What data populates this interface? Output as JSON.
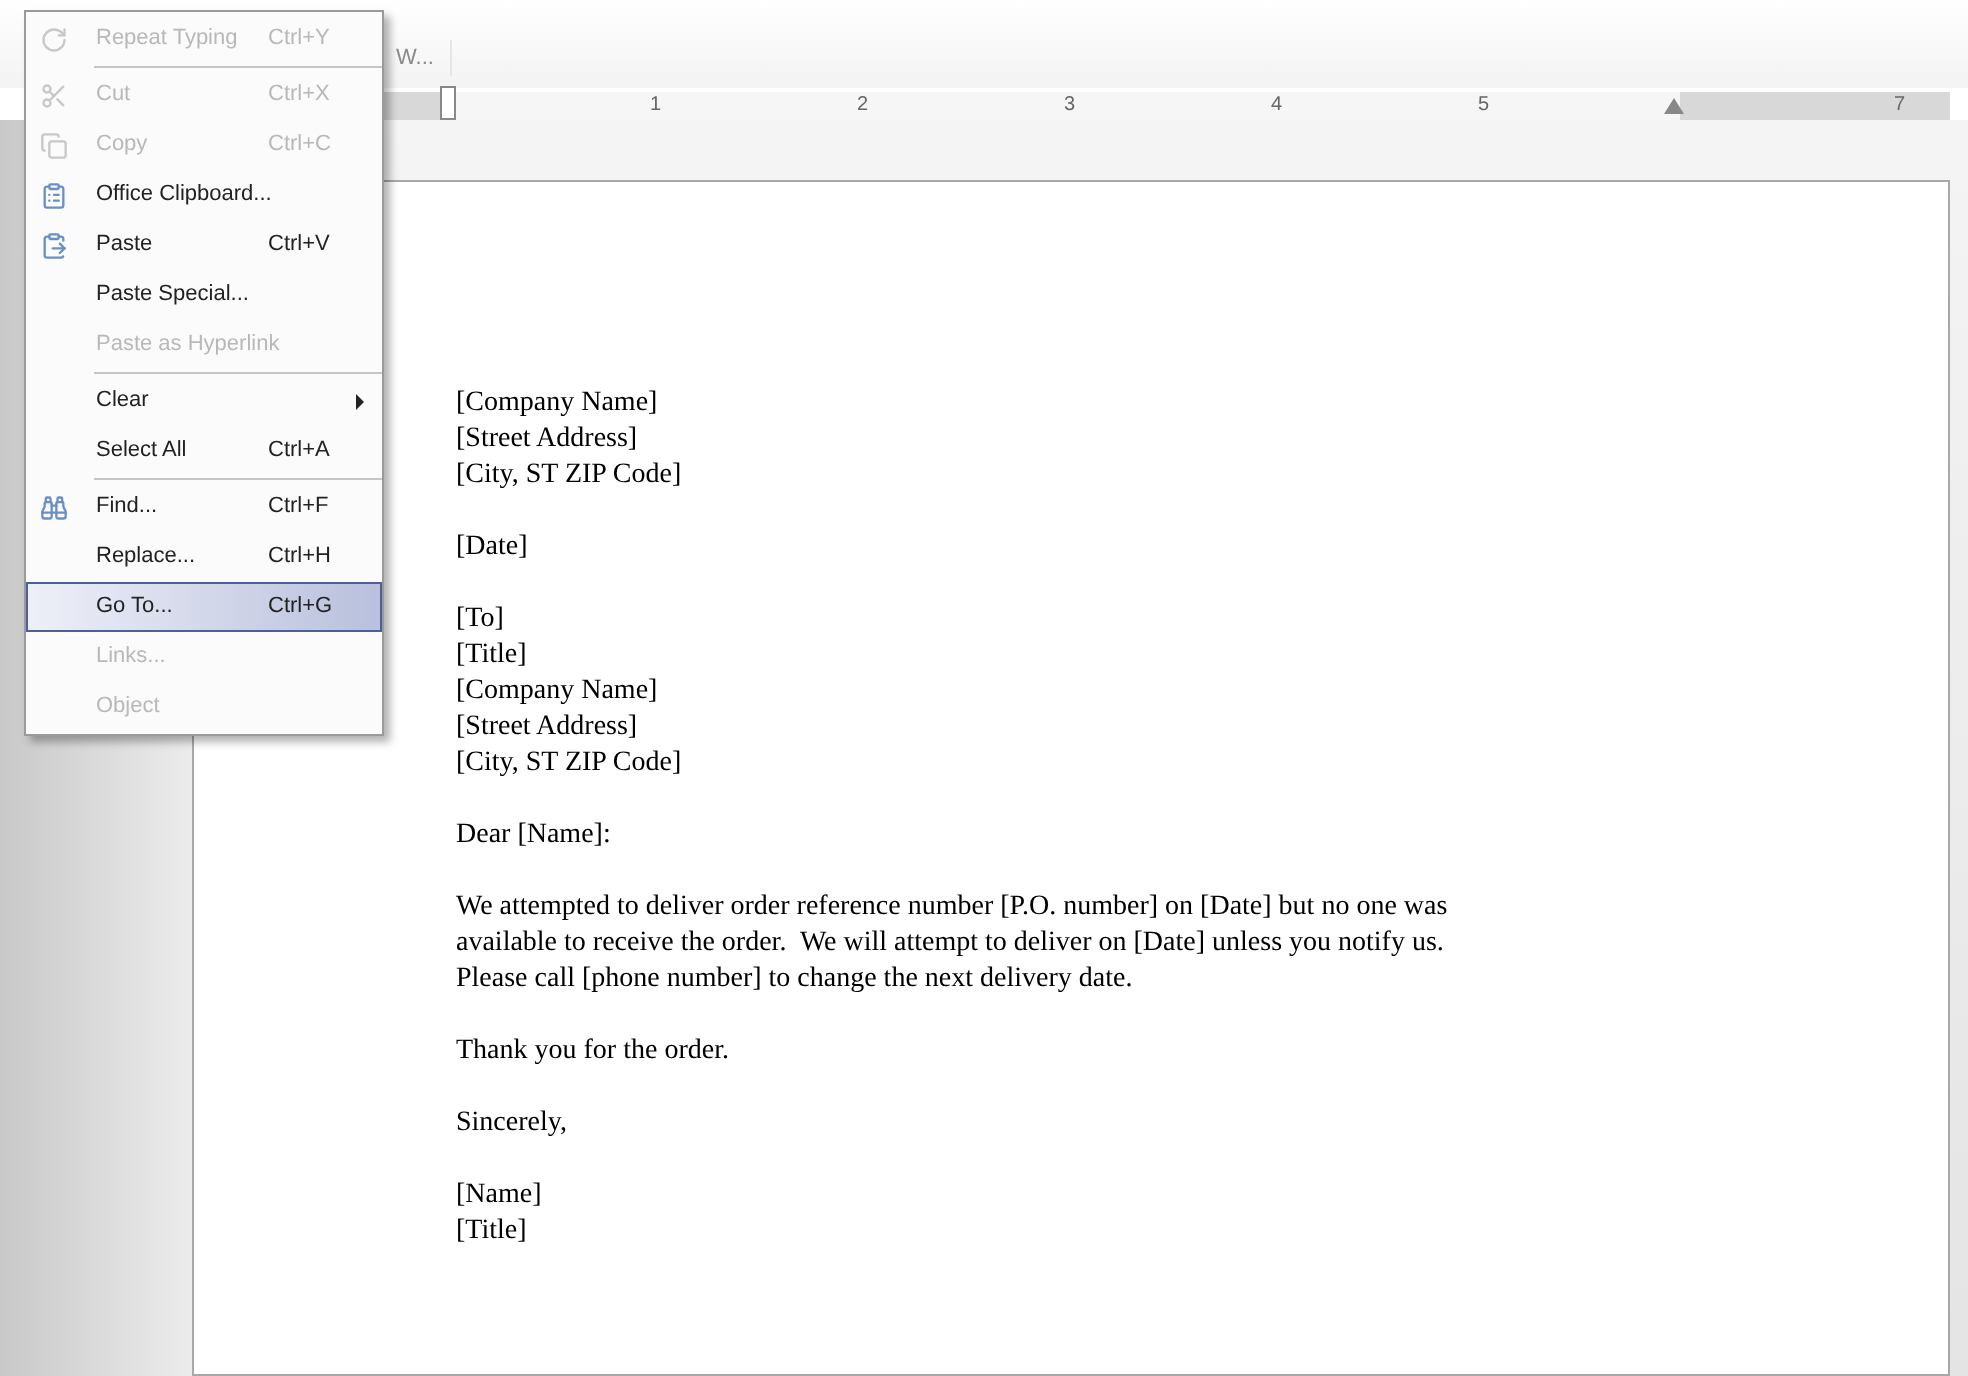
{
  "toolbar": {
    "text": "W..."
  },
  "ruler": {
    "numbers": [
      "1",
      "2",
      "3",
      "4",
      "5",
      "7"
    ]
  },
  "edit_menu": {
    "items": [
      {
        "kind": "item",
        "label": "Repeat Typing",
        "shortcut": "Ctrl+Y",
        "disabled": true,
        "selected": false
      },
      {
        "kind": "separator"
      },
      {
        "kind": "item",
        "label": "Cut",
        "shortcut": "Ctrl+X",
        "disabled": true,
        "selected": false
      },
      {
        "kind": "item",
        "label": "Copy",
        "shortcut": "Ctrl+C",
        "disabled": true,
        "selected": false
      },
      {
        "kind": "item",
        "label": "Office Clipboard...",
        "disabled": false,
        "selected": false
      },
      {
        "kind": "item",
        "label": "Paste",
        "shortcut": "Ctrl+V",
        "disabled": false,
        "selected": false
      },
      {
        "kind": "item",
        "label": "Paste Special...",
        "disabled": false,
        "selected": false
      },
      {
        "kind": "item",
        "label": "Paste as Hyperlink",
        "disabled": true,
        "selected": false
      },
      {
        "kind": "separator"
      },
      {
        "kind": "submenu",
        "label": "Clear",
        "disabled": false,
        "selected": false
      },
      {
        "kind": "item",
        "label": "Select All",
        "shortcut": "Ctrl+A",
        "disabled": false,
        "selected": false
      },
      {
        "kind": "separator"
      },
      {
        "kind": "item",
        "label": "Find...",
        "shortcut": "Ctrl+F",
        "disabled": false,
        "selected": false
      },
      {
        "kind": "item",
        "label": "Replace...",
        "shortcut": "Ctrl+H",
        "disabled": false,
        "selected": false
      },
      {
        "kind": "item",
        "label": "Go To...",
        "shortcut": "Ctrl+G",
        "disabled": false,
        "selected": true
      },
      {
        "kind": "item",
        "label": "Links...",
        "disabled": true,
        "selected": false
      },
      {
        "kind": "item",
        "label": "Object",
        "disabled": true,
        "selected": false
      }
    ]
  },
  "document": {
    "paragraphs": [
      [
        "[Company Name]",
        "[Street Address]",
        "[City, ST ZIP Code]"
      ],
      [
        "[Date]"
      ],
      [
        "[To]",
        "[Title]",
        "[Company Name]",
        "[Street Address]",
        "[City, ST ZIP Code]"
      ],
      [
        "Dear [Name]:"
      ],
      [
        "We attempted to deliver order reference number [P.O. number] on [Date] but no one was",
        "available to receive the order.  We will attempt to deliver on [Date] unless you notify us.",
        "Please call [phone number] to change the next delivery date."
      ],
      [
        "Thank you for the order."
      ],
      [
        "Sincerely,"
      ],
      [
        "[Name]",
        "[Title]"
      ]
    ]
  }
}
